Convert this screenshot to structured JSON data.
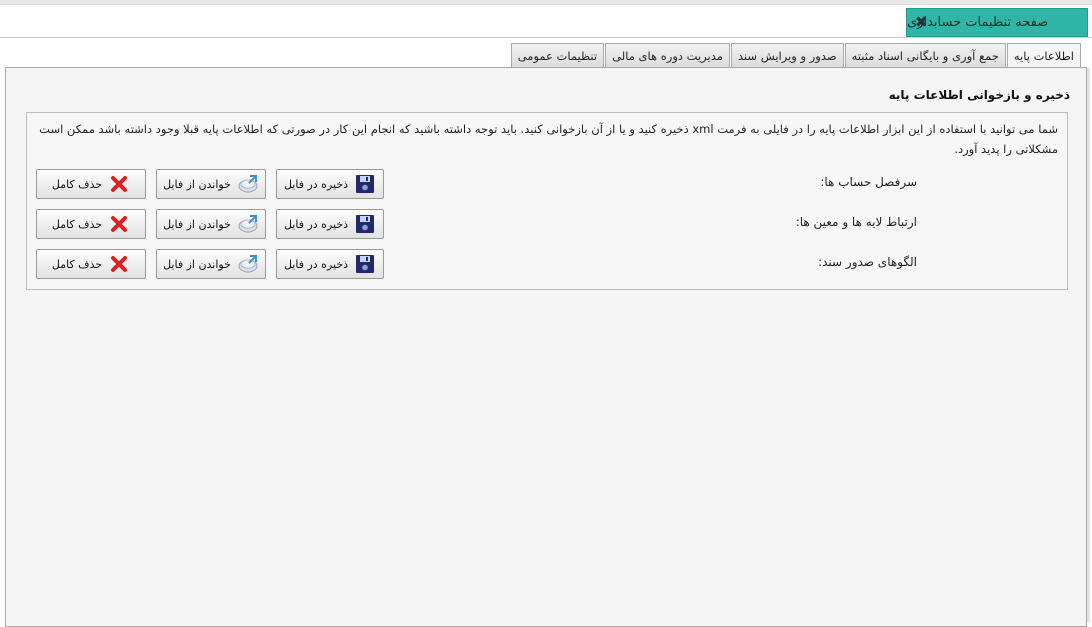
{
  "window": {
    "title": "صفحه تنظیمات حسابداری",
    "close_icon": "close-icon"
  },
  "tabs": [
    {
      "label": "اطلاعات پایه",
      "active": true
    },
    {
      "label": "جمع آوری و بایگانی اسناد مثبته",
      "active": false
    },
    {
      "label": "صدور و ویرایش سند",
      "active": false
    },
    {
      "label": "مدیریت دوره های مالی",
      "active": false
    },
    {
      "label": "تنظیمات عمومی",
      "active": false
    }
  ],
  "section": {
    "title": "ذخیره و بازخوانی اطلاعات پایه",
    "description": "شما می توانید با استفاده از این ابزار اطلاعات پایه را در فایلی به فرمت xml ذخیره کنید و یا از آن بازخوانی کنید. باید توجه داشته باشید که انجام این کار در صورتی که اطلاعات پایه قبلا وجود داشته باشد ممکن است مشکلاتی را پدید آورد."
  },
  "rows": [
    {
      "label": "سرفصل حساب ها:",
      "save": "ذخیره در فایل",
      "read": "خواندن از فایل",
      "delete": "حذف کامل"
    },
    {
      "label": "ارتباط لایه ها و معین ها:",
      "save": "ذخیره در فایل",
      "read": "خواندن از فایل",
      "delete": "حذف کامل"
    },
    {
      "label": "الگوهای صدور سند:",
      "save": "ذخیره در فایل",
      "read": "خواندن از فایل",
      "delete": "حذف کامل"
    }
  ],
  "icons": {
    "save": "floppy-disk-icon",
    "read": "load-file-icon",
    "delete": "red-x-icon"
  },
  "colors": {
    "title_tab": "#2fb6a6",
    "delete_icon": "#e02020",
    "save_icon": "#1e2a6b"
  }
}
